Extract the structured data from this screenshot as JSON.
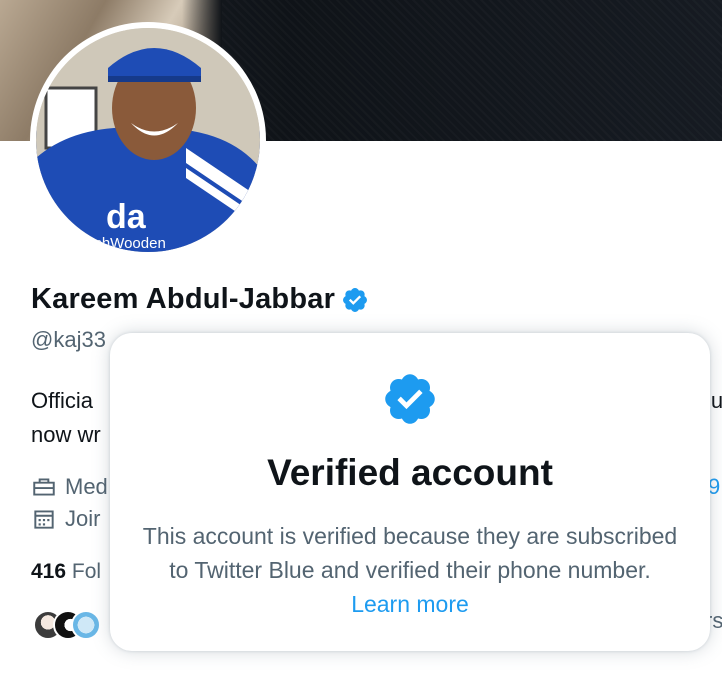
{
  "profile": {
    "name": "Kareem Abdul-Jabbar",
    "handle": "@kaj33",
    "bio_line1": "Officia",
    "bio_line2": "now wr",
    "bio_right_fragment": "lu",
    "meta_category": "Med",
    "meta_joined": "Joir",
    "meta_right_fragment": "9",
    "following_count": "416",
    "following_fragment": "Fol",
    "followers_fragment": "rs",
    "avatar_caption": "achWooden"
  },
  "icons": {
    "verified": "verified-badge-icon",
    "briefcase": "briefcase-icon",
    "calendar": "calendar-icon"
  },
  "verified_popup": {
    "title": "Verified account",
    "text": "This account is verified because they are subscribed to Twitter Blue and verified their phone number.",
    "link": "Learn more"
  },
  "colors": {
    "accent": "#1d9bf0",
    "secondary_text": "#536471",
    "primary_text": "#0f1419"
  }
}
